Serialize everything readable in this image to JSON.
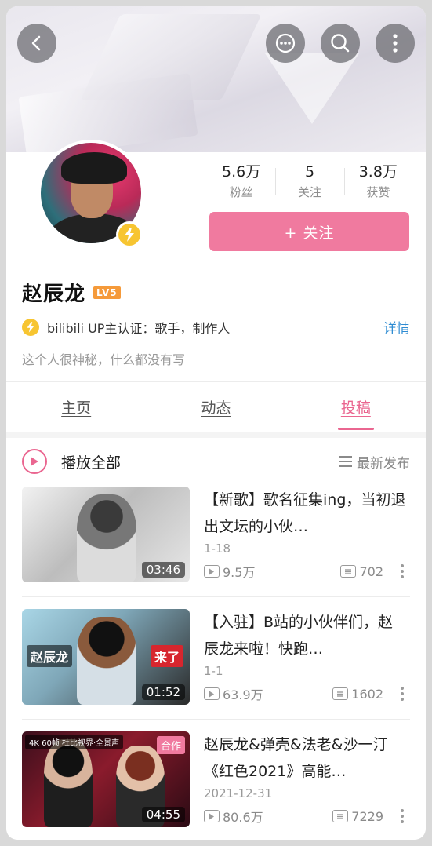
{
  "header": {
    "back_icon": "chevron-left-icon",
    "chat_icon": "chat-bubble-icon",
    "search_icon": "search-icon",
    "menu_icon": "vertical-dots-icon"
  },
  "profile": {
    "stats": [
      {
        "value": "5.6万",
        "label": "粉丝"
      },
      {
        "value": "5",
        "label": "关注"
      },
      {
        "value": "3.8万",
        "label": "获赞"
      }
    ],
    "follow_label": "+ 关注",
    "name": "赵辰龙",
    "level": "LV5",
    "verify_text": "bilibili  UP主认证：歌手，制作人",
    "detail_label": "详情",
    "bio": "这个人很神秘，什么都没有写"
  },
  "tabs": [
    {
      "label": "主页"
    },
    {
      "label": "动态"
    },
    {
      "label": "投稿"
    }
  ],
  "playall": {
    "label": "播放全部",
    "sort_label": "最新发布"
  },
  "videos": [
    {
      "title": "【新歌】歌名征集ing，当初退出文坛的小伙…",
      "date": "1-18",
      "duration": "03:46",
      "views": "9.5万",
      "comments": "702"
    },
    {
      "title": "【入驻】B站的小伙伴们，赵辰龙来啦！快跑…",
      "date": "1-1",
      "duration": "01:52",
      "views": "63.9万",
      "comments": "1602",
      "thumb_left_text": "赵辰龙",
      "thumb_right_text": "来了"
    },
    {
      "title": "赵辰龙&弹壳&法老&沙一汀《红色2021》高能…",
      "date": "2021-12-31",
      "duration": "04:55",
      "views": "80.6万",
      "comments": "7229",
      "thumb_top_text": "4K 60帧 杜比视界·全景声",
      "thumb_badge": "合作"
    }
  ],
  "colors": {
    "accent": "#ea6690",
    "follow_button": "#f07a9f",
    "link": "#2d8bd2",
    "verify_badge": "#f7c531"
  }
}
